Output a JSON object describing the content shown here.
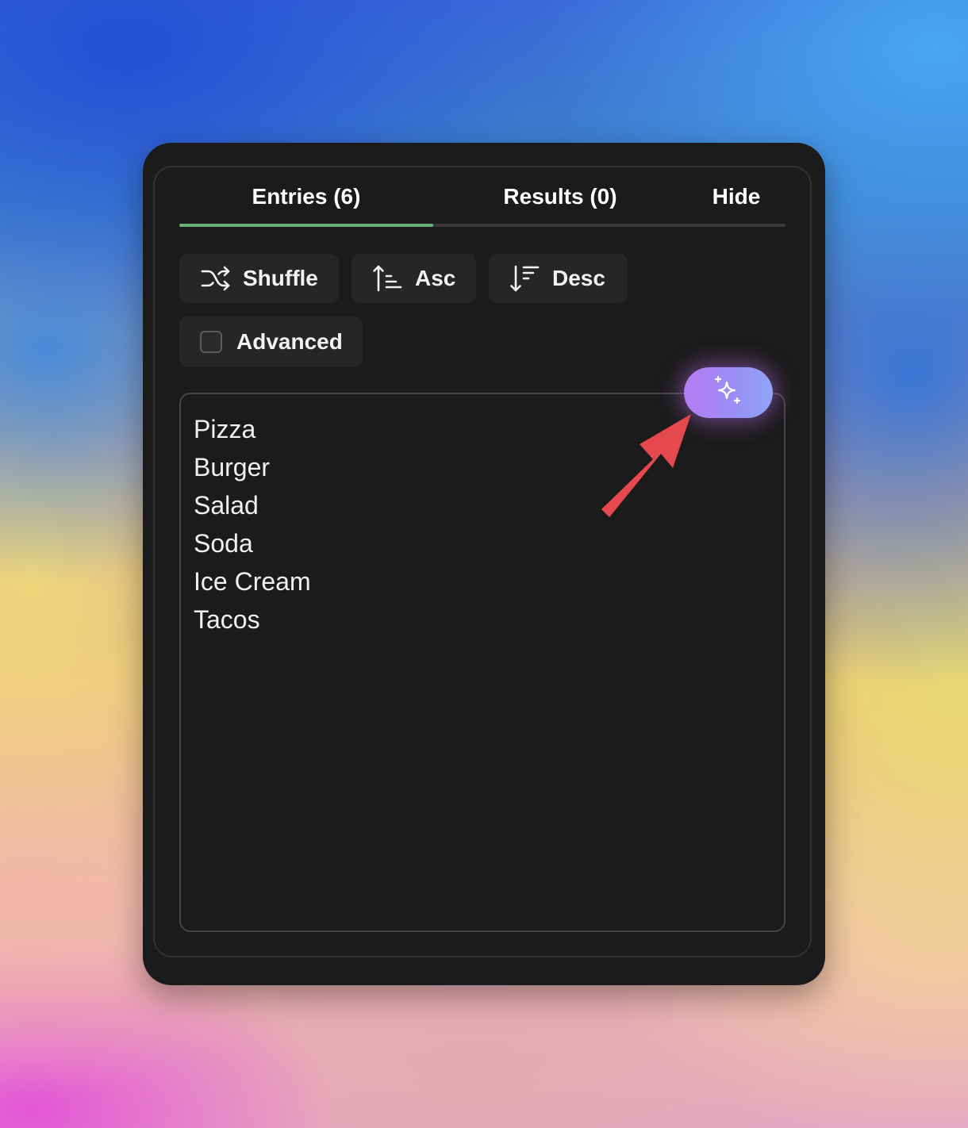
{
  "tabs": {
    "entries_label": "Entries (6)",
    "results_label": "Results (0)",
    "hide_label": "Hide",
    "active": "entries"
  },
  "toolbar": {
    "shuffle_label": "Shuffle",
    "shuffle_icon": "shuffle-icon",
    "asc_label": "Asc",
    "asc_icon": "sort-ascending-icon",
    "desc_label": "Desc",
    "desc_icon": "sort-descending-icon",
    "advanced_label": "Advanced",
    "advanced_checked": false
  },
  "entries": [
    "Pizza",
    "Burger",
    "Salad",
    "Soda",
    "Ice Cream",
    "Tacos"
  ],
  "magic_button": {
    "icon": "sparkles-icon"
  },
  "colors": {
    "panel": "#1b1b1b",
    "tab_active_indicator": "#6cb07a",
    "magic_gradient_start": "#b47cf2",
    "magic_gradient_end": "#8fa4f7",
    "annotation_arrow": "#e5484d"
  }
}
